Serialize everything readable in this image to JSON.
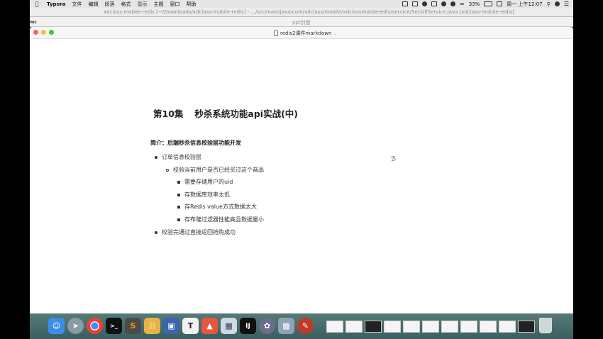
{
  "menubar": {
    "app": "Typora",
    "items": [
      "文件",
      "编辑",
      "段落",
      "格式",
      "显示",
      "主题",
      "窗口",
      "帮助"
    ],
    "battery": "33%",
    "clock": "周一 上午12:07"
  },
  "background_windows": {
    "ide_title": "xdclass-mobile-redis [~/Downloads/xdclass-mobile-redis] - .../src/main/java/com/xdclass/mobile/xdclassmobileredis/service/SeckillService.java [xdclass-mobile-redis]",
    "ppt_title": "ppt封面",
    "side_label": "mc"
  },
  "window": {
    "title": "redis2课件markdown"
  },
  "document": {
    "heading_num": "第10集",
    "heading_text": "秒杀系统功能api实战(中)",
    "intro": "简介：后端秒杀信息校验层功能开发",
    "list": {
      "item1": "订单信息校验层",
      "item1_sub": "校验当前用户是否已经买过这个商品",
      "item1_sub_points": [
        "需要存储用户的uid",
        "存数据库效率太低",
        "存Redis value方式数据太大",
        "存布隆过滤器性能高且数据量小"
      ],
      "item2": "校验完通过直接返回抢购成功"
    }
  },
  "dock": {
    "apps": [
      "finder-icon",
      "launchpad-icon",
      "chrome-icon",
      "terminal-icon",
      "sublime-icon",
      "sequel-icon",
      "vm-icon",
      "typora-icon",
      "git-icon",
      "preview-icon",
      "intellij-icon",
      "xmind-icon",
      "image-icon",
      "tool-icon"
    ],
    "colors": {
      "accent_red": "#fc605c",
      "accent_yellow": "#fdbc40",
      "accent_green": "#34c84a",
      "dock_bg": "#4a6e6c"
    }
  }
}
